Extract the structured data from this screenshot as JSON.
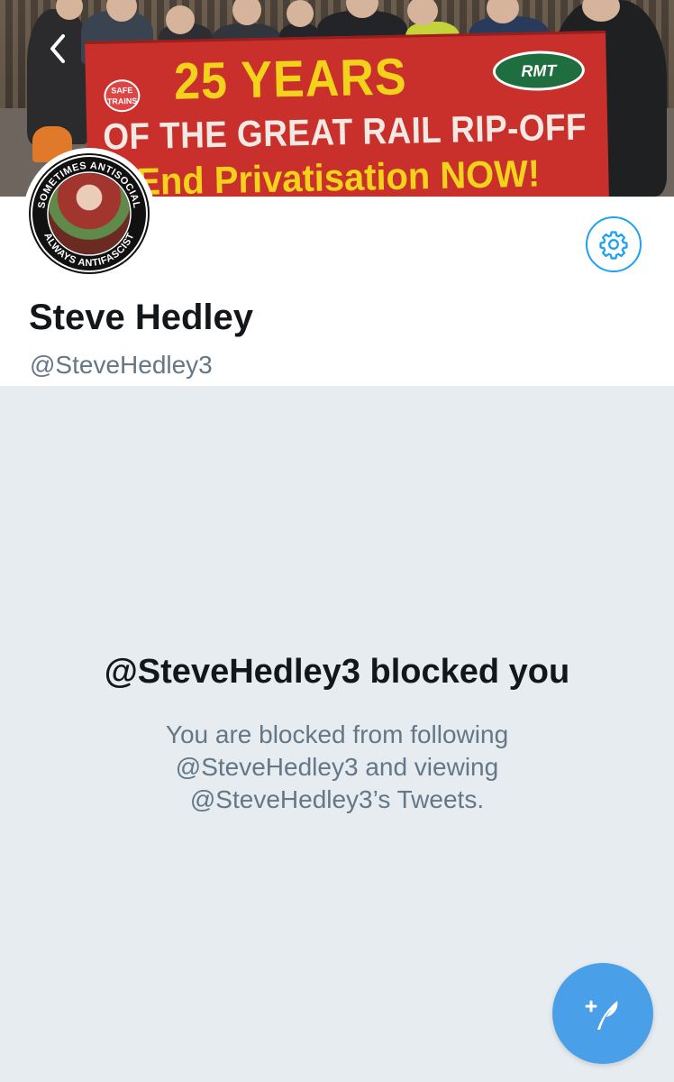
{
  "banner": {
    "line1": "25 YEARS",
    "line2": "OF THE GREAT RAIL RIP-OFF",
    "line3": "End Privatisation NOW!",
    "logo_left": "SAFE TRAINS",
    "logo_right": "RMT"
  },
  "nav": {
    "back_icon": "chevron-left-icon"
  },
  "profile": {
    "display_name": "Steve Hedley",
    "handle": "@SteveHedley3",
    "avatar_ring_top": "SOMETIMES ANTISOCIAL",
    "avatar_ring_bottom": "ALWAYS ANTIFASCIST",
    "settings_icon": "gear-icon"
  },
  "blocked": {
    "title": "@SteveHedley3 blocked you",
    "line1": "You are blocked from following",
    "line2": "@SteveHedley3 and viewing",
    "line3": "@SteveHedley3’s Tweets."
  },
  "compose": {
    "icon": "compose-tweet-icon"
  },
  "colors": {
    "accent": "#1da1f2",
    "fab": "#4aa0e8",
    "background": "#e6ecf0",
    "secondary_text": "#657786",
    "primary_text": "#14171a"
  }
}
